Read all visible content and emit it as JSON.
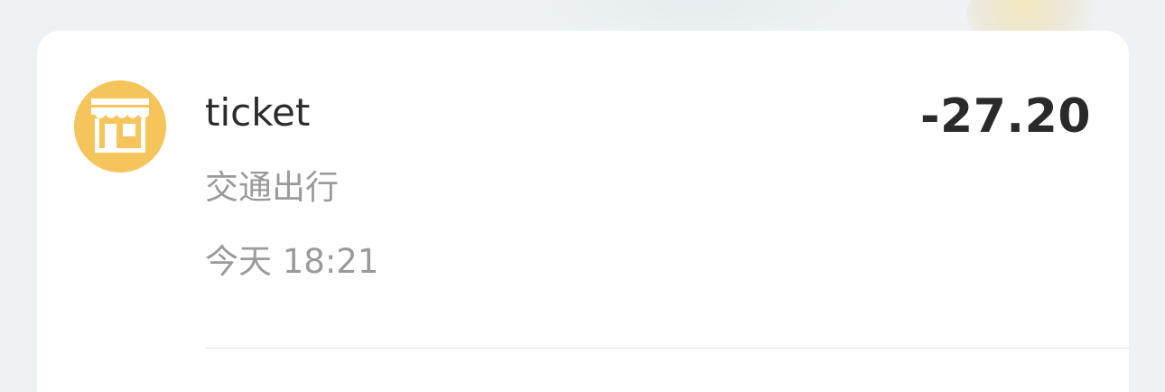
{
  "transaction": {
    "icon": "shop-icon",
    "title": "ticket",
    "amount": "-27.20",
    "category": "交通出行",
    "time": "今天 18:21"
  },
  "colors": {
    "icon_background": "#f5c55c",
    "card_background": "#ffffff",
    "page_background": "#eef2f5"
  }
}
